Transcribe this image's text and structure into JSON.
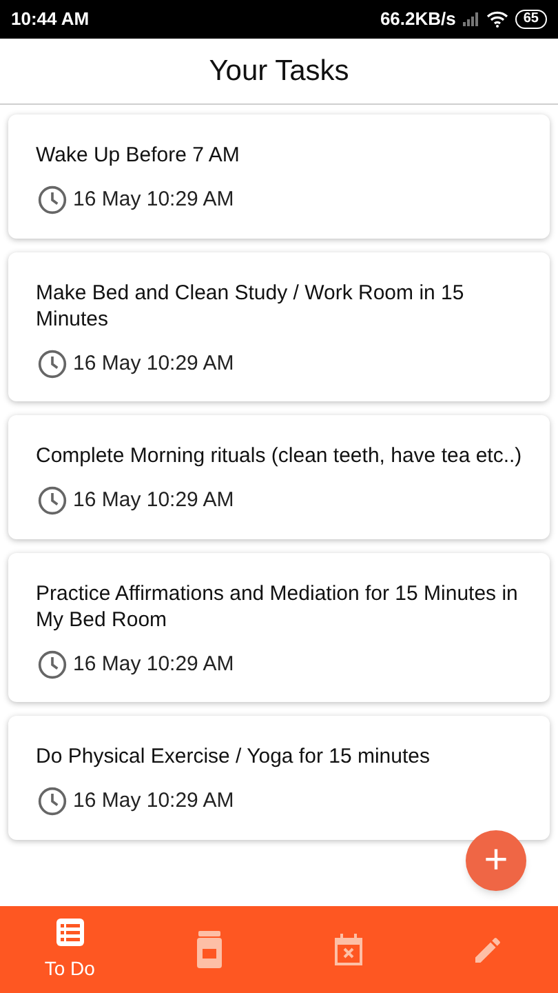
{
  "status_bar": {
    "time": "10:44 AM",
    "speed": "66.2KB/s",
    "battery": "65"
  },
  "header": {
    "title": "Your Tasks"
  },
  "tasks": [
    {
      "title": "Wake Up Before 7 AM",
      "time": "16 May 10:29 AM"
    },
    {
      "title": "Make Bed and Clean Study / Work Room in 15 Minutes",
      "time": "16 May 10:29 AM"
    },
    {
      "title": "Complete Morning rituals (clean teeth, have tea etc..)",
      "time": "16 May 10:29 AM"
    },
    {
      "title": "Practice Affirmations and Mediation for 15 Minutes in My Bed Room",
      "time": "16 May 10:29 AM"
    },
    {
      "title": "Do Physical Exercise / Yoga for 15 minutes",
      "time": "16 May 10:29 AM"
    }
  ],
  "fab": {
    "label": "+"
  },
  "bottom_nav": [
    {
      "kind": "list",
      "label": "To Do",
      "selected": true
    },
    {
      "kind": "jar",
      "selected": false
    },
    {
      "kind": "calendar",
      "selected": false
    },
    {
      "kind": "pencil",
      "selected": false
    }
  ]
}
